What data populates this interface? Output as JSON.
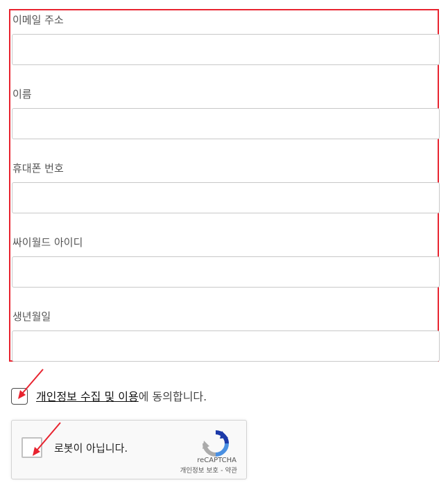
{
  "form": {
    "fields": [
      {
        "label": "이메일 주소",
        "value": ""
      },
      {
        "label": "이름",
        "value": ""
      },
      {
        "label": "휴대폰 번호",
        "value": ""
      },
      {
        "label": "싸이월드 아이디",
        "value": ""
      },
      {
        "label": "생년월일",
        "value": ""
      }
    ]
  },
  "consent": {
    "link_text": "개인정보 수집 및 이용",
    "suffix_text": "에 동의합니다.",
    "checked": false
  },
  "recaptcha": {
    "label": "로봇이 아닙니다.",
    "brand": "reCAPTCHA",
    "privacy_link": "개인정보 보호",
    "separator": " - ",
    "terms_link": "약관",
    "checked": false
  },
  "colors": {
    "highlight_border": "#e8232f",
    "annotation_arrow": "#e8232f",
    "recaptcha_blue": "#4a90e2",
    "recaptcha_dark_blue": "#1c3aa9",
    "recaptcha_gray": "#ababab"
  },
  "icons": {
    "recaptcha_logo": "recaptcha-logo-icon",
    "annotation": "red-arrow-icon"
  }
}
